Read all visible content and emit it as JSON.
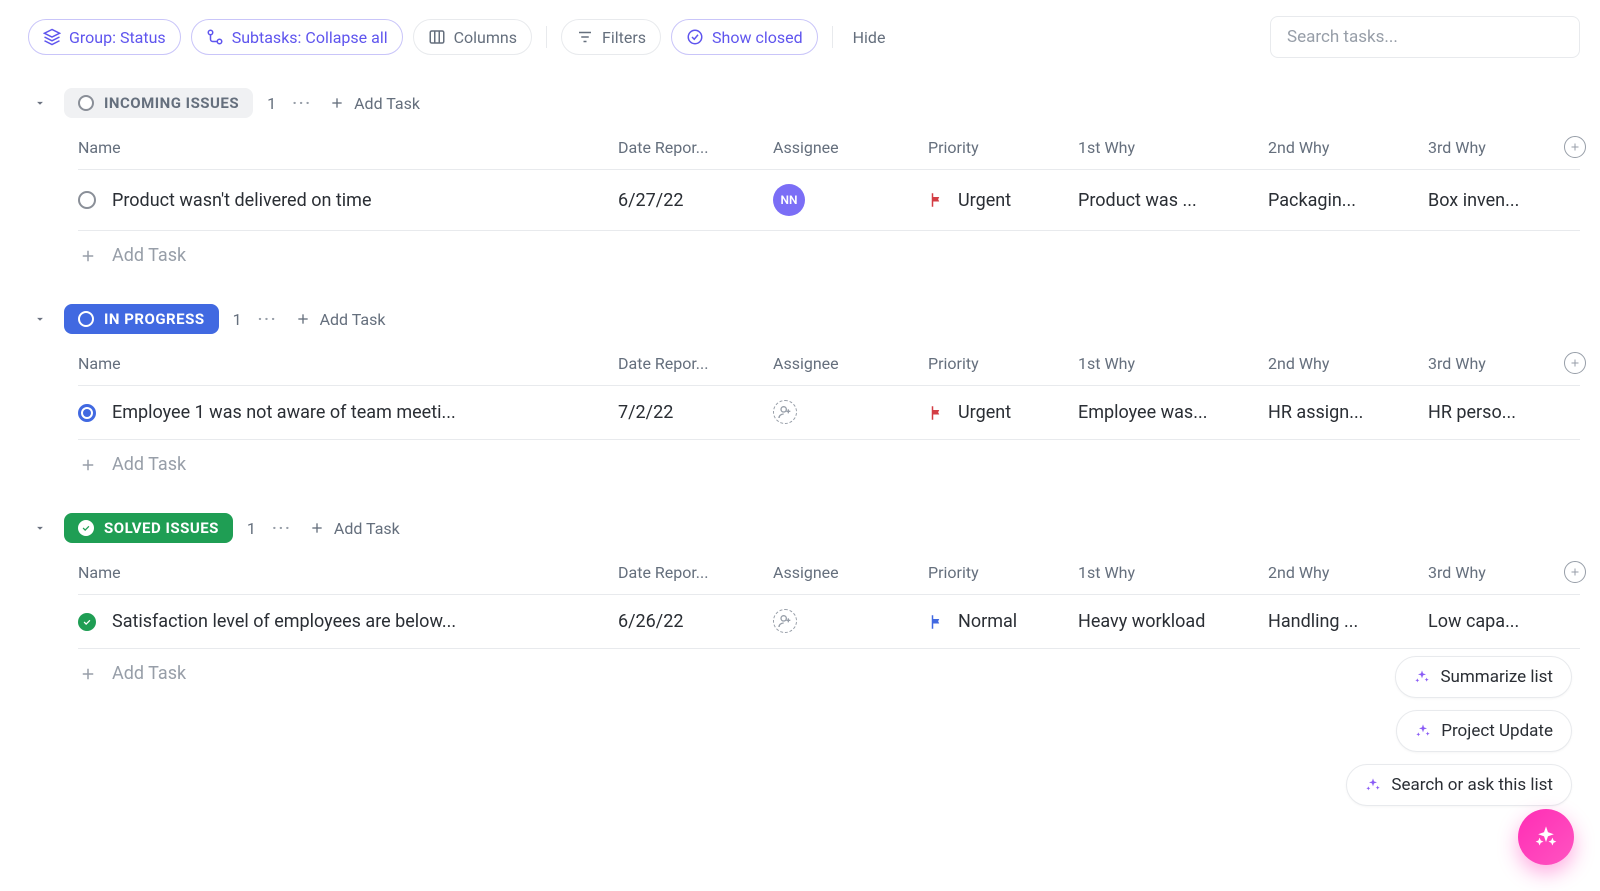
{
  "toolbar": {
    "group_label": "Group: Status",
    "subtasks_label": "Subtasks: Collapse all",
    "columns_label": "Columns",
    "filters_label": "Filters",
    "show_closed_label": "Show closed",
    "hide_label": "Hide"
  },
  "search": {
    "placeholder": "Search tasks..."
  },
  "columns": {
    "name": "Name",
    "date_reported": "Date Repor...",
    "assignee": "Assignee",
    "priority": "Priority",
    "why1": "1st Why",
    "why2": "2nd Why",
    "why3": "3rd Why"
  },
  "common": {
    "add_task": "Add Task",
    "more": "···"
  },
  "groups": [
    {
      "key": "incoming",
      "label": "INCOMING ISSUES",
      "count": "1",
      "chip_class": "gray",
      "rows": [
        {
          "status_class": "gray",
          "name": "Product wasn't delivered on time",
          "date": "6/27/22",
          "assignee": {
            "initials": "NN",
            "kind": "avatar"
          },
          "priority": {
            "label": "Urgent",
            "color": "#d33d44"
          },
          "why1": "Product was ...",
          "why2": "Packagin...",
          "why3": "Box inven..."
        }
      ]
    },
    {
      "key": "inprogress",
      "label": "IN PROGRESS",
      "count": "1",
      "chip_class": "blue",
      "rows": [
        {
          "status_class": "blue",
          "name": "Employee 1 was not aware of team meeti...",
          "date": "7/2/22",
          "assignee": {
            "kind": "empty"
          },
          "priority": {
            "label": "Urgent",
            "color": "#d33d44"
          },
          "why1": "Employee was...",
          "why2": "HR assign...",
          "why3": "HR perso..."
        }
      ]
    },
    {
      "key": "solved",
      "label": "SOLVED ISSUES",
      "count": "1",
      "chip_class": "green",
      "rows": [
        {
          "status_class": "green",
          "name": "Satisfaction level of employees are below...",
          "date": "6/26/22",
          "assignee": {
            "kind": "empty"
          },
          "priority": {
            "label": "Normal",
            "color": "#4169e1"
          },
          "why1": "Heavy workload",
          "why2": "Handling ...",
          "why3": "Low capa..."
        }
      ]
    }
  ],
  "ai": {
    "summarize": "Summarize list",
    "project_update": "Project Update",
    "search_ask": "Search or ask this list"
  }
}
